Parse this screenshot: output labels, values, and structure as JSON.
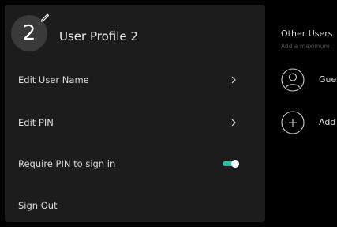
{
  "profile": {
    "avatar_number": "2",
    "name": "User Profile 2"
  },
  "menu": {
    "items": [
      {
        "label": "Edit User Name",
        "trailing": "chevron-right-icon"
      },
      {
        "label": "Edit PIN",
        "trailing": "chevron-right-icon"
      },
      {
        "label": "Require PIN to sign in",
        "trailing": "toggle",
        "enabled": true
      },
      {
        "label": "Sign Out"
      }
    ]
  },
  "other_users": {
    "title": "Other Users",
    "subtitle": "Add a maximum",
    "items": [
      {
        "label": "Gue",
        "icon": "user-avatar-icon"
      },
      {
        "label": "Add",
        "icon": "plus-circle-icon"
      }
    ]
  },
  "colors": {
    "background": "#000000",
    "panel": "#1c1c1c",
    "toggle_on": "#2fbfa8"
  }
}
